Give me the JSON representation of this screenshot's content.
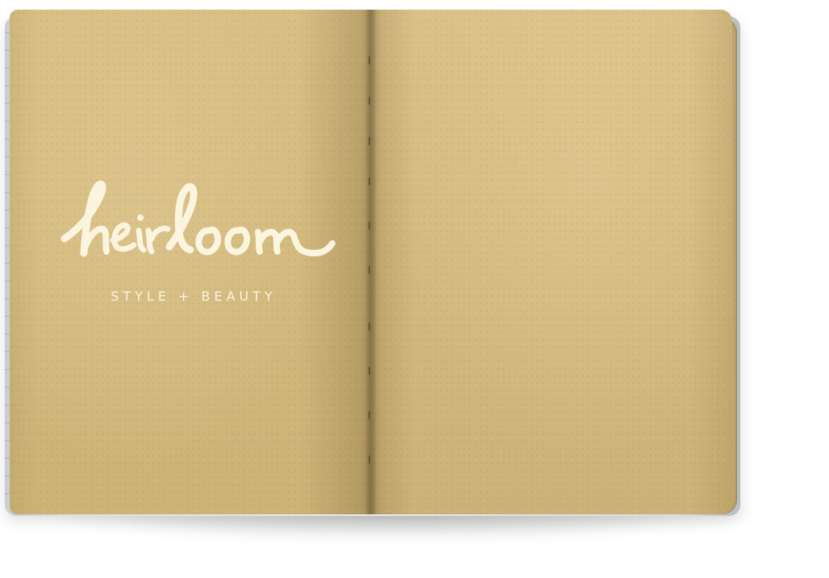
{
  "logo": {
    "wordmark": "heirloom",
    "tagline": "STYLE + BEAUTY"
  },
  "colors": {
    "kraft_paper": "#d3b97e",
    "logo_ink": "#fbf4df",
    "cover": "#e4e7ea",
    "background": "#ffffff"
  }
}
